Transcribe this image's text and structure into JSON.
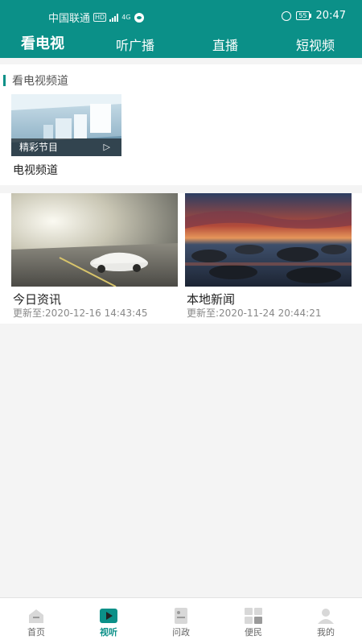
{
  "status_bar": {
    "carrier": "中国联通",
    "hd_badge": "HD",
    "network": "4G",
    "battery": "55",
    "time": "20:47"
  },
  "top_tabs": [
    {
      "label": "看电视",
      "active": true
    },
    {
      "label": "听广播",
      "active": false
    },
    {
      "label": "直播",
      "active": false
    },
    {
      "label": "短视频",
      "active": false
    }
  ],
  "section_tv": {
    "title": "看电视频道",
    "card": {
      "overlay_text": "精彩节目",
      "label": "电视频道"
    }
  },
  "news": [
    {
      "title": "今日资讯",
      "updated": "更新至:2020-12-16 14:43:45"
    },
    {
      "title": "本地新闻",
      "updated": "更新至:2020-11-24 20:44:21"
    }
  ],
  "bottom_nav": [
    {
      "label": "首页",
      "icon": "home-icon",
      "active": false
    },
    {
      "label": "视听",
      "icon": "play-icon",
      "active": true
    },
    {
      "label": "问政",
      "icon": "document-icon",
      "active": false
    },
    {
      "label": "便民",
      "icon": "grid-icon",
      "active": false
    },
    {
      "label": "我的",
      "icon": "user-icon",
      "active": false
    }
  ],
  "colors": {
    "accent": "#0b9088",
    "background": "#f4f4f4"
  }
}
